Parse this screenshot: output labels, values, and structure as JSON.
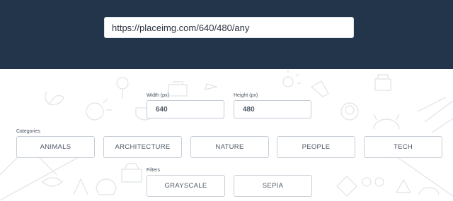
{
  "url_field": {
    "value": "https://placeimg.com/640/480/any"
  },
  "dimensions": {
    "width_label": "Width (px)",
    "width_value": "640",
    "height_label": "Height (px)",
    "height_value": "480"
  },
  "categories": {
    "label": "Categories",
    "items": [
      "ANIMALS",
      "ARCHITECTURE",
      "NATURE",
      "PEOPLE",
      "TECH"
    ]
  },
  "filters": {
    "label": "Filters",
    "items": [
      "GRAYSCALE",
      "SEPIA"
    ]
  },
  "colors": {
    "hero_background": "#22354b",
    "doodle_stroke": "#dfe3e7"
  }
}
